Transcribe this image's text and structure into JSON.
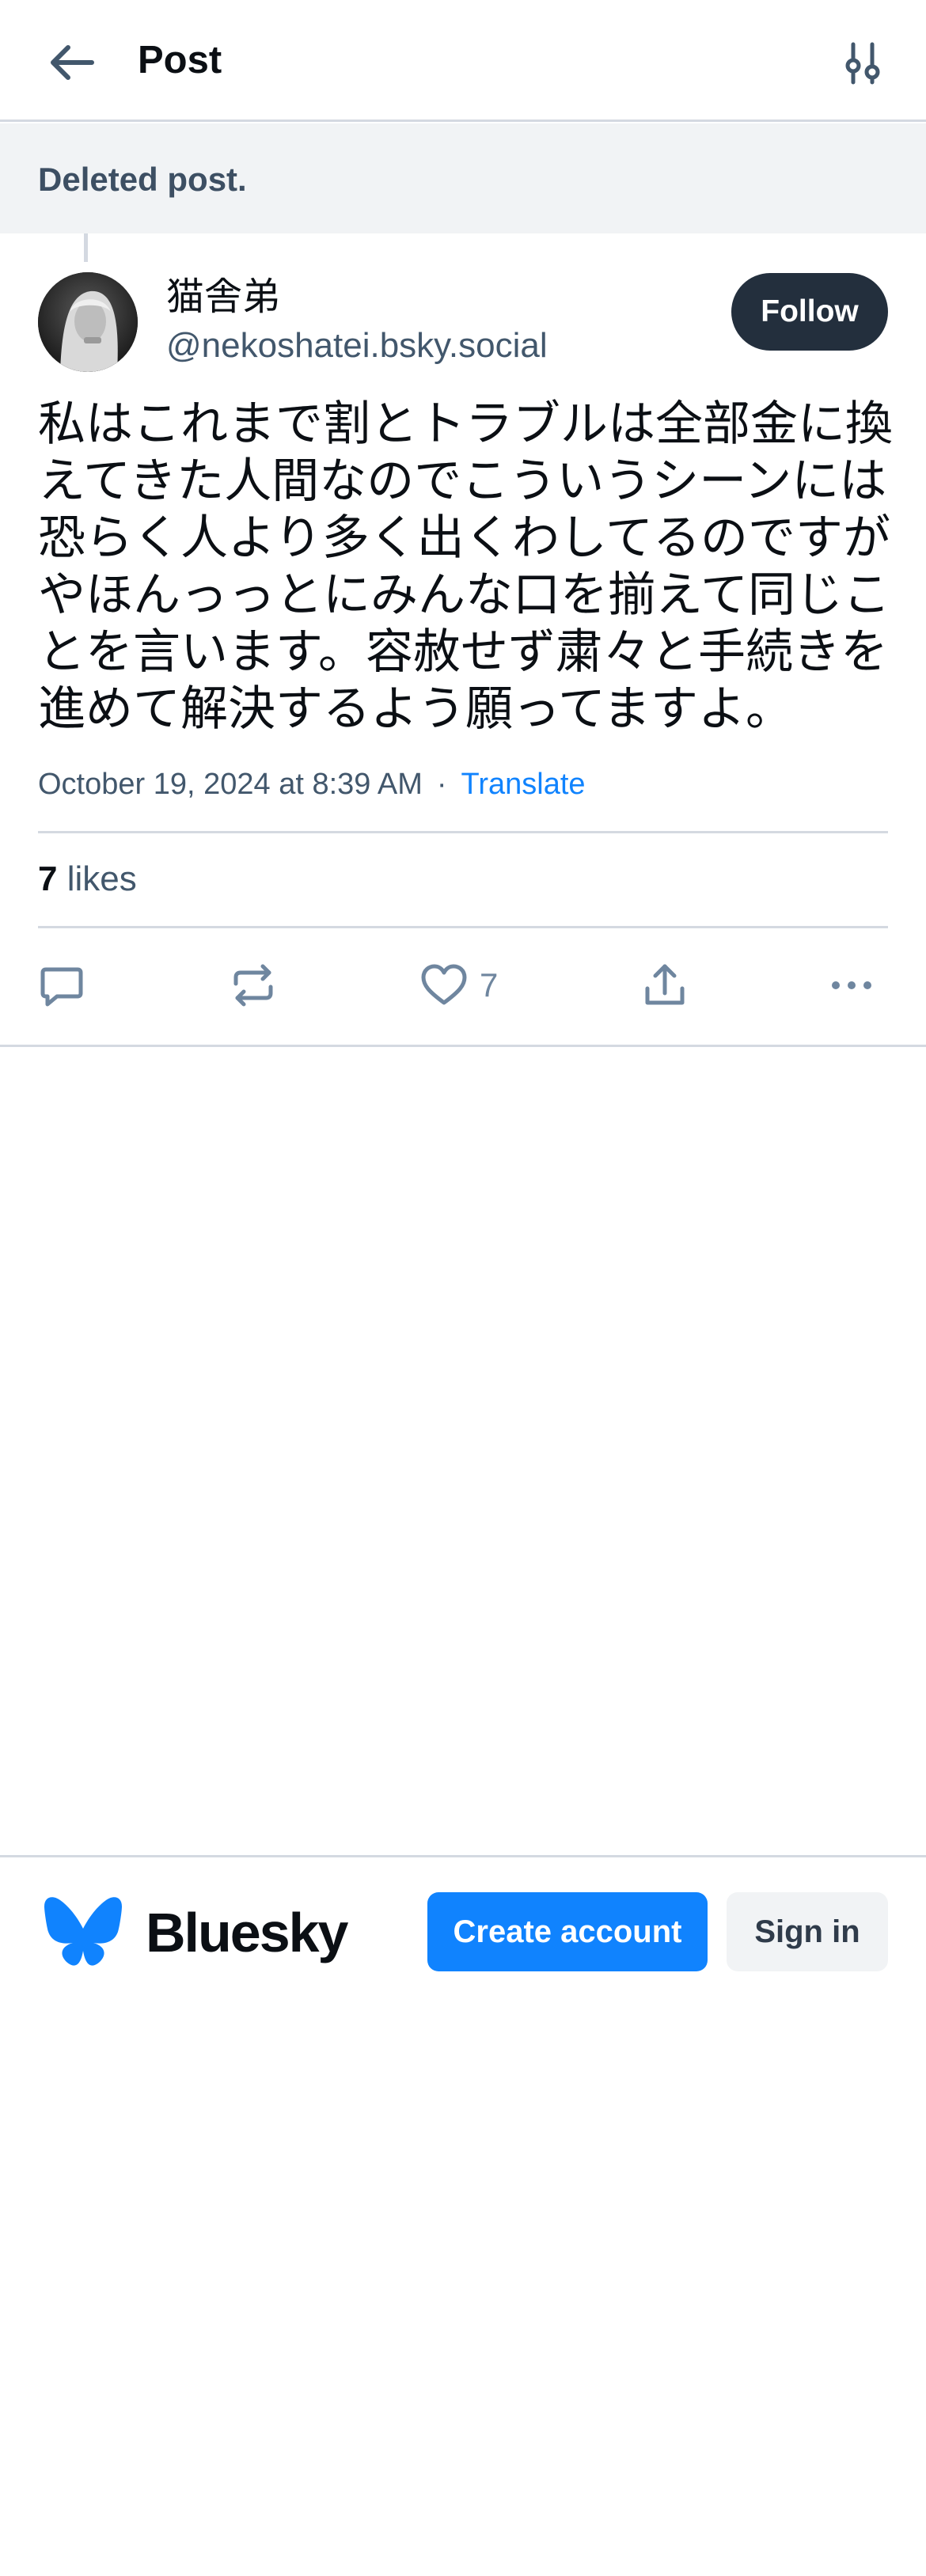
{
  "header": {
    "back_icon": "arrow-left-icon",
    "title": "Post",
    "filter_icon": "sliders-icon"
  },
  "parent": {
    "deleted_text": "Deleted post."
  },
  "post": {
    "author": {
      "display_name": "猫舎弟",
      "handle": "@nekoshatei.bsky.social",
      "follow_label": "Follow"
    },
    "text": "私はこれまで割とトラブルは全部金に換えてきた人間なのでこういうシーンには恐らく人より多く出くわしてるのですがやほんっっとにみんな口を揃えて同じことを言います。容赦せず粛々と手続きを進めて解決するよう願ってますよ。",
    "timestamp": "October 19, 2024 at 8:39 AM",
    "separator": "·",
    "translate_label": "Translate",
    "likes_count": "7",
    "likes_label": "likes"
  },
  "actions": {
    "reply_icon": "reply-bubble-icon",
    "repost_icon": "repost-icon",
    "like_icon": "heart-icon",
    "like_count": "7",
    "share_icon": "share-icon",
    "more_icon": "more-dots-icon"
  },
  "footer": {
    "brand": "Bluesky",
    "create_account_label": "Create account",
    "sign_in_label": "Sign in"
  },
  "colors": {
    "accent": "#1083fe",
    "follow_bg": "#232f3d",
    "muted_text": "#42576c",
    "icon": "#6f869f",
    "divider": "#d4d9e1"
  }
}
